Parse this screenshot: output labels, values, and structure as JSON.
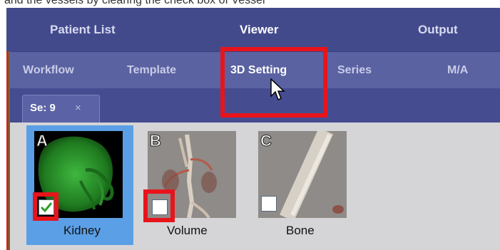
{
  "caption": "and the vessels by clearing the check box of Vessel",
  "nav": {
    "tabs": [
      {
        "label": "Patient List",
        "active": false
      },
      {
        "label": "Viewer",
        "active": true
      },
      {
        "label": "Output",
        "active": false
      }
    ]
  },
  "subnav": {
    "tabs": [
      {
        "label": "Workflow",
        "active": false
      },
      {
        "label": "Template",
        "active": false
      },
      {
        "label": "3D Setting",
        "active": true
      },
      {
        "label": "Series",
        "active": false
      },
      {
        "label": "M/A",
        "active": false
      }
    ]
  },
  "series_tab": {
    "label": "Se: 9",
    "close_glyph": "×"
  },
  "thumbnails": [
    {
      "letter": "A",
      "name": "Kidney",
      "checked": true,
      "selected": true
    },
    {
      "letter": "B",
      "name": "Volume",
      "checked": false,
      "selected": false
    },
    {
      "letter": "C",
      "name": "Bone",
      "checked": false,
      "selected": false
    }
  ],
  "colors": {
    "nav_bg": "#434a8c",
    "subnav_bg": "#5a62a2",
    "highlight": "#e8141c",
    "selection": "#5b9fe6",
    "check": "#2e9e2e"
  }
}
